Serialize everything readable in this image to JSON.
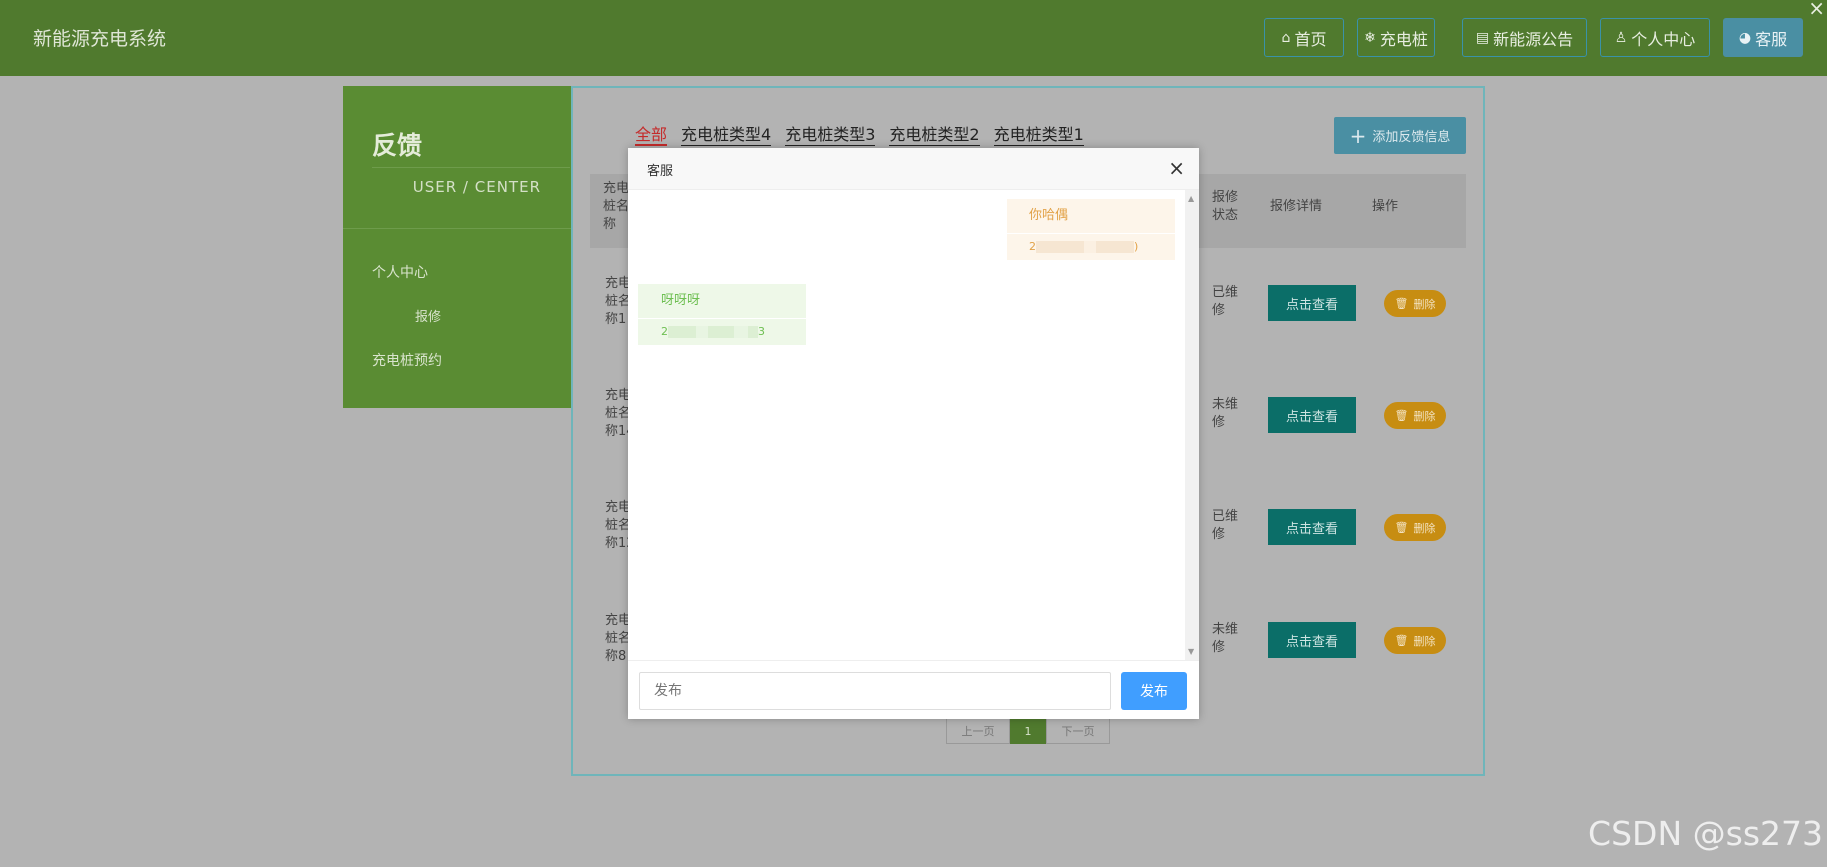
{
  "header": {
    "brand": "新能源充电系统",
    "nav": [
      {
        "icon": "home-icon",
        "glyph": "⌂",
        "label": "首页"
      },
      {
        "icon": "snowflake-icon",
        "glyph": "❄",
        "label": "充电桩"
      },
      {
        "icon": "notice-icon",
        "glyph": "▤",
        "label": "新能源公告"
      },
      {
        "icon": "user-icon",
        "glyph": "♙",
        "label": "个人中心"
      },
      {
        "icon": "headset-icon",
        "glyph": "◕",
        "label": "客服"
      }
    ]
  },
  "sidebar": {
    "title": "反馈",
    "subtitle": "USER / CENTER",
    "items": [
      {
        "label": "个人中心"
      },
      {
        "label": "报修"
      },
      {
        "label": "充电桩预约"
      }
    ]
  },
  "main": {
    "tabs": [
      "全部",
      "充电桩类型4",
      "充电桩类型3",
      "充电桩类型2",
      "充电桩类型1"
    ],
    "add_label": "添加反馈信息",
    "columns": {
      "name": "充电\n桩名\n称",
      "status": "报修\n状态",
      "detail": "报修详情",
      "action": "操作"
    },
    "rows": [
      {
        "name": "充电\n桩名\n称1",
        "status": "已维\n修",
        "view": "点击查看",
        "delete": "删除"
      },
      {
        "name": "充电\n桩名\n称14",
        "status": "未维\n修",
        "view": "点击查看",
        "delete": "删除"
      },
      {
        "name": "充电\n桩名\n称12",
        "status": "已维\n修",
        "view": "点击查看",
        "delete": "删除"
      },
      {
        "name": "充电\n桩名\n称8",
        "status": "未维\n修",
        "view": "点击查看",
        "delete": "删除"
      }
    ],
    "pager": {
      "prev": "上一页",
      "current": "1",
      "next": "下一页"
    }
  },
  "modal": {
    "title": "客服",
    "messages": [
      {
        "side": "right",
        "text": "你哈偶",
        "time_start": "2",
        "time_end": ")"
      },
      {
        "side": "left",
        "text": "呀呀呀",
        "time_start": "2",
        "time_end": "3"
      }
    ],
    "input_placeholder": "发布",
    "send_label": "发布"
  },
  "watermark": "CSDN @ss273",
  "colors": {
    "header_bg": "#507a2e",
    "sidebar_bg": "#5a8c33",
    "view_btn": "#0b6e68",
    "delete_btn": "#c78d12",
    "send_btn": "#409eff",
    "active_tab": "#c42b2b"
  }
}
